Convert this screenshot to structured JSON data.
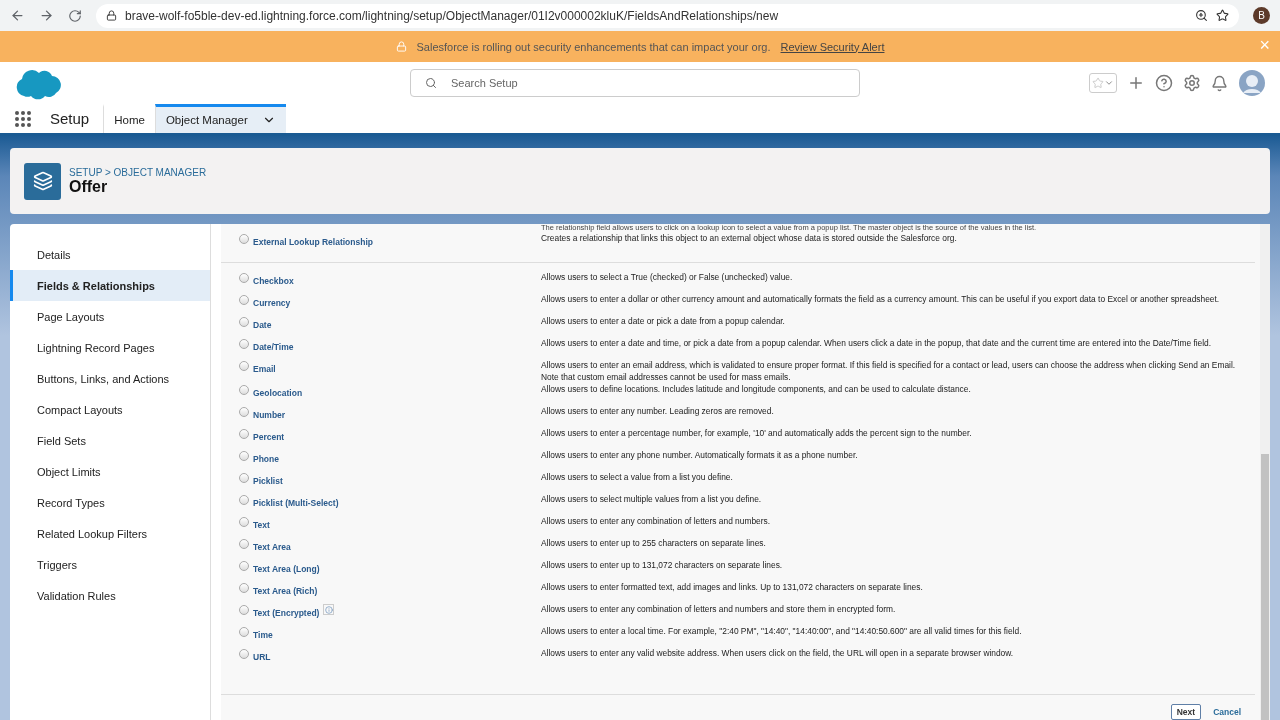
{
  "browser": {
    "url": "brave-wolf-fo5ble-dev-ed.lightning.force.com/lightning/setup/ObjectManager/01I2v000002kluK/FieldsAndRelationships/new",
    "avatar": "B"
  },
  "banner": {
    "message": "Salesforce is rolling out security enhancements that can impact your org.",
    "link": "Review Security Alert",
    "close": "×"
  },
  "header": {
    "search_placeholder": "Search Setup"
  },
  "nav": {
    "app": "Setup",
    "tabs": [
      {
        "label": "Home",
        "selected": false,
        "menu": false
      },
      {
        "label": "Object Manager",
        "selected": true,
        "menu": true
      }
    ]
  },
  "page": {
    "breadcrumb": "SETUP > OBJECT MANAGER",
    "title": "Offer"
  },
  "sidebar": {
    "items": [
      {
        "label": "Details",
        "selected": false
      },
      {
        "label": "Fields & Relationships",
        "selected": true
      },
      {
        "label": "Page Layouts",
        "selected": false
      },
      {
        "label": "Lightning Record Pages",
        "selected": false
      },
      {
        "label": "Buttons, Links, and Actions",
        "selected": false
      },
      {
        "label": "Compact Layouts",
        "selected": false
      },
      {
        "label": "Field Sets",
        "selected": false
      },
      {
        "label": "Object Limits",
        "selected": false
      },
      {
        "label": "Record Types",
        "selected": false
      },
      {
        "label": "Related Lookup Filters",
        "selected": false
      },
      {
        "label": "Triggers",
        "selected": false
      },
      {
        "label": "Validation Rules",
        "selected": false
      }
    ]
  },
  "top_note": "The relationship field allows users to click on a lookup icon to select a value from a popup list. The master object is the source of the values in the list.",
  "relationship_types": [
    {
      "label": "External Lookup Relationship",
      "description": "Creates a relationship that links this object to an external object whose data is stored outside the Salesforce org.",
      "selected": false
    }
  ],
  "field_types": [
    {
      "label": "Checkbox",
      "description": "Allows users to select a True (checked) or False (unchecked) value.",
      "selected": false
    },
    {
      "label": "Currency",
      "description": "Allows users to enter a dollar or other currency amount and automatically formats the field as a currency amount. This can be useful if you export data to Excel or another spreadsheet.",
      "selected": false
    },
    {
      "label": "Date",
      "description": "Allows users to enter a date or pick a date from a popup calendar.",
      "selected": false
    },
    {
      "label": "Date/Time",
      "description": "Allows users to enter a date and time, or pick a date from a popup calendar. When users click a date in the popup, that date and the current time are entered into the Date/Time field.",
      "selected": false
    },
    {
      "label": "Email",
      "description": "Allows users to enter an email address, which is validated to ensure proper format. If this field is specified for a contact or lead, users can choose the address when clicking Send an Email. Note that custom email addresses cannot be used for mass emails.",
      "selected": false
    },
    {
      "label": "Geolocation",
      "description": "Allows users to define locations. Includes latitude and longitude components, and can be used to calculate distance.",
      "selected": false
    },
    {
      "label": "Number",
      "description": "Allows users to enter any number. Leading zeros are removed.",
      "selected": false
    },
    {
      "label": "Percent",
      "description": "Allows users to enter a percentage number, for example, '10' and automatically adds the percent sign to the number.",
      "selected": false
    },
    {
      "label": "Phone",
      "description": "Allows users to enter any phone number. Automatically formats it as a phone number.",
      "selected": false
    },
    {
      "label": "Picklist",
      "description": "Allows users to select a value from a list you define.",
      "selected": false
    },
    {
      "label": "Picklist (Multi-Select)",
      "description": "Allows users to select multiple values from a list you define.",
      "selected": false
    },
    {
      "label": "Text",
      "description": "Allows users to enter any combination of letters and numbers.",
      "selected": false
    },
    {
      "label": "Text Area",
      "description": "Allows users to enter up to 255 characters on separate lines.",
      "selected": false
    },
    {
      "label": "Text Area (Long)",
      "description": "Allows users to enter up to 131,072 characters on separate lines.",
      "selected": false
    },
    {
      "label": "Text Area (Rich)",
      "description": "Allows users to enter formatted text, add images and links. Up to 131,072 characters on separate lines.",
      "selected": false
    },
    {
      "label": "Text (Encrypted)",
      "description": "Allows users to enter any combination of letters and numbers and store them in encrypted form.",
      "selected": false,
      "info": true
    },
    {
      "label": "Time",
      "description": "Allows users to enter a local time. For example, \"2:40 PM\", \"14:40\", \"14:40:00\", and \"14:40:50.600\" are all valid times for this field.",
      "selected": false
    },
    {
      "label": "URL",
      "description": "Allows users to enter any valid website address. When users click on the field, the URL will open in a separate browser window.",
      "selected": false
    }
  ],
  "buttons": [
    "Next",
    "Cancel"
  ]
}
